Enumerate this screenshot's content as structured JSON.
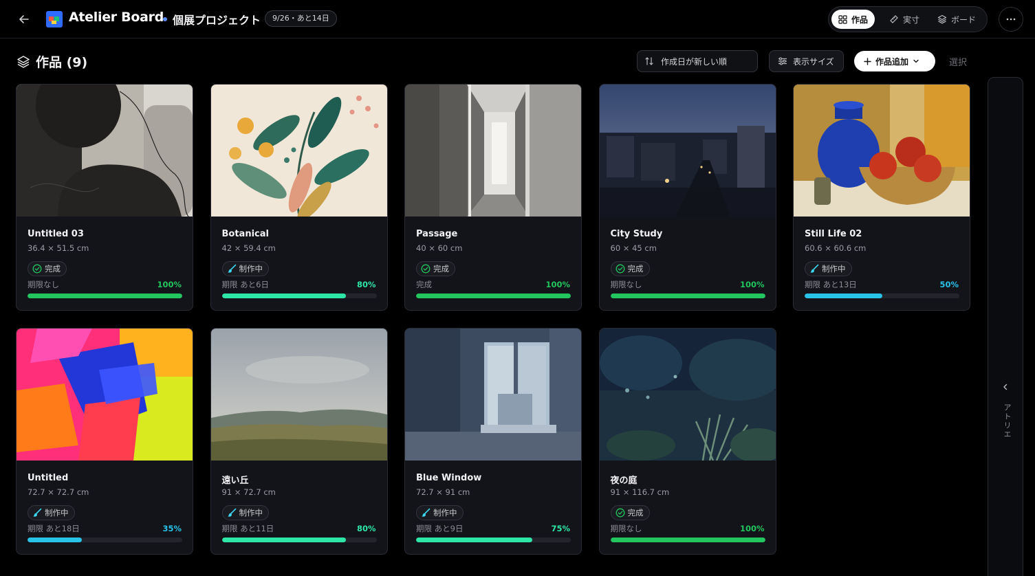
{
  "header": {
    "app_title": "Atelier Board",
    "project_name": "個展プロジェクト",
    "date_badge": "9/26・あと14日",
    "views": [
      {
        "label": "作品",
        "active": true
      },
      {
        "label": "実寸",
        "active": false
      },
      {
        "label": "ボード",
        "active": false
      }
    ]
  },
  "toolbar": {
    "title": "作品 (9)",
    "sort_label": "作成日が新しい順",
    "size_label": "表示サイズ",
    "add_label": "作品追加",
    "select_label": "選択"
  },
  "side_panel": {
    "label": "アトリエ"
  },
  "colors": {
    "green": "#22c55e",
    "teal": "#2ee6a6",
    "cyan": "#28c3e6"
  },
  "works": [
    {
      "title": "Untitled 03",
      "size": "36.4 × 51.5 cm",
      "status": "完成",
      "status_type": "done",
      "due": "期限なし",
      "progress_label": "100%",
      "progress": 1.0
    },
    {
      "title": "Botanical",
      "size": "42 × 59.4 cm",
      "status": "制作中",
      "status_type": "wip",
      "due": "期限 あと6日",
      "progress_label": "80%",
      "progress": 0.8
    },
    {
      "title": "Passage",
      "size": "40 × 60 cm",
      "status": "完成",
      "status_type": "done",
      "due": "完成",
      "progress_label": "100%",
      "progress": 1.0
    },
    {
      "title": "City Study",
      "size": "60 × 45 cm",
      "status": "完成",
      "status_type": "done",
      "due": "期限なし",
      "progress_label": "100%",
      "progress": 1.0
    },
    {
      "title": "Still Life 02",
      "size": "60.6 × 60.6 cm",
      "status": "制作中",
      "status_type": "wip",
      "due": "期限 あと13日",
      "progress_label": "50%",
      "progress": 0.5
    },
    {
      "title": "Untitled",
      "size": "72.7 × 72.7 cm",
      "status": "制作中",
      "status_type": "wip",
      "due": "期限 あと18日",
      "progress_label": "35%",
      "progress": 0.35
    },
    {
      "title": "遠い丘",
      "size": "91 × 72.7 cm",
      "status": "制作中",
      "status_type": "wip",
      "due": "期限 あと11日",
      "progress_label": "80%",
      "progress": 0.8
    },
    {
      "title": "Blue Window",
      "size": "72.7 × 91 cm",
      "status": "制作中",
      "status_type": "wip",
      "due": "期限 あと9日",
      "progress_label": "75%",
      "progress": 0.75
    },
    {
      "title": "夜の庭",
      "size": "91 × 116.7 cm",
      "status": "完成",
      "status_type": "done",
      "due": "期限なし",
      "progress_label": "100%",
      "progress": 1.0
    }
  ]
}
